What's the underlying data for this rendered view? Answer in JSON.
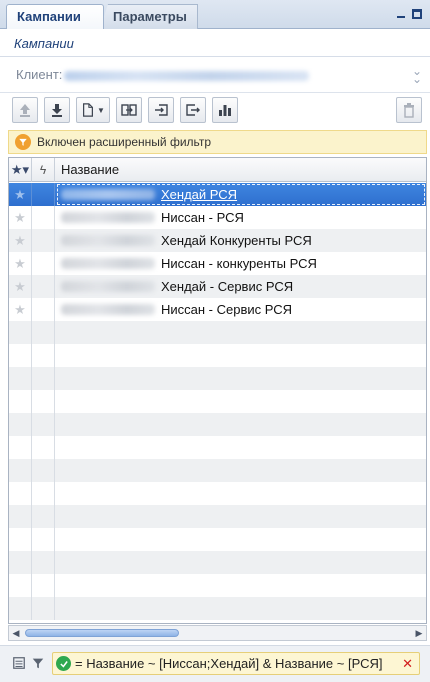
{
  "tabs": [
    {
      "label": "Кампании",
      "active": true
    },
    {
      "label": "Параметры",
      "active": false
    }
  ],
  "section_title": "Кампании",
  "client": {
    "label": "Клиент:"
  },
  "filter_banner": {
    "text": "Включен расширенный фильтр"
  },
  "grid": {
    "columns": {
      "star": "★▾",
      "bolt": "ϟ",
      "name": "Название"
    },
    "rows": [
      {
        "name": "Хендай РСЯ",
        "selected": true
      },
      {
        "name": "Ниссан - РСЯ",
        "selected": false
      },
      {
        "name": "Хендай Конкуренты РСЯ",
        "selected": false
      },
      {
        "name": "Ниссан - конкуренты РСЯ",
        "selected": false
      },
      {
        "name": "Хендай - Сервис РСЯ",
        "selected": false
      },
      {
        "name": "Ниссан - Сервис РСЯ",
        "selected": false
      }
    ]
  },
  "bottom_bar": {
    "filter_expression": "= Название ~ [Ниссан;Хендай] & Название ~ [РСЯ]",
    "clear_symbol": "✕"
  },
  "colors": {
    "selection": "#2e6fce",
    "tab_text": "#20427a",
    "banner_bg": "#fbf3cc",
    "filter_ok": "#2fa84f",
    "clear": "#d21c1c"
  }
}
